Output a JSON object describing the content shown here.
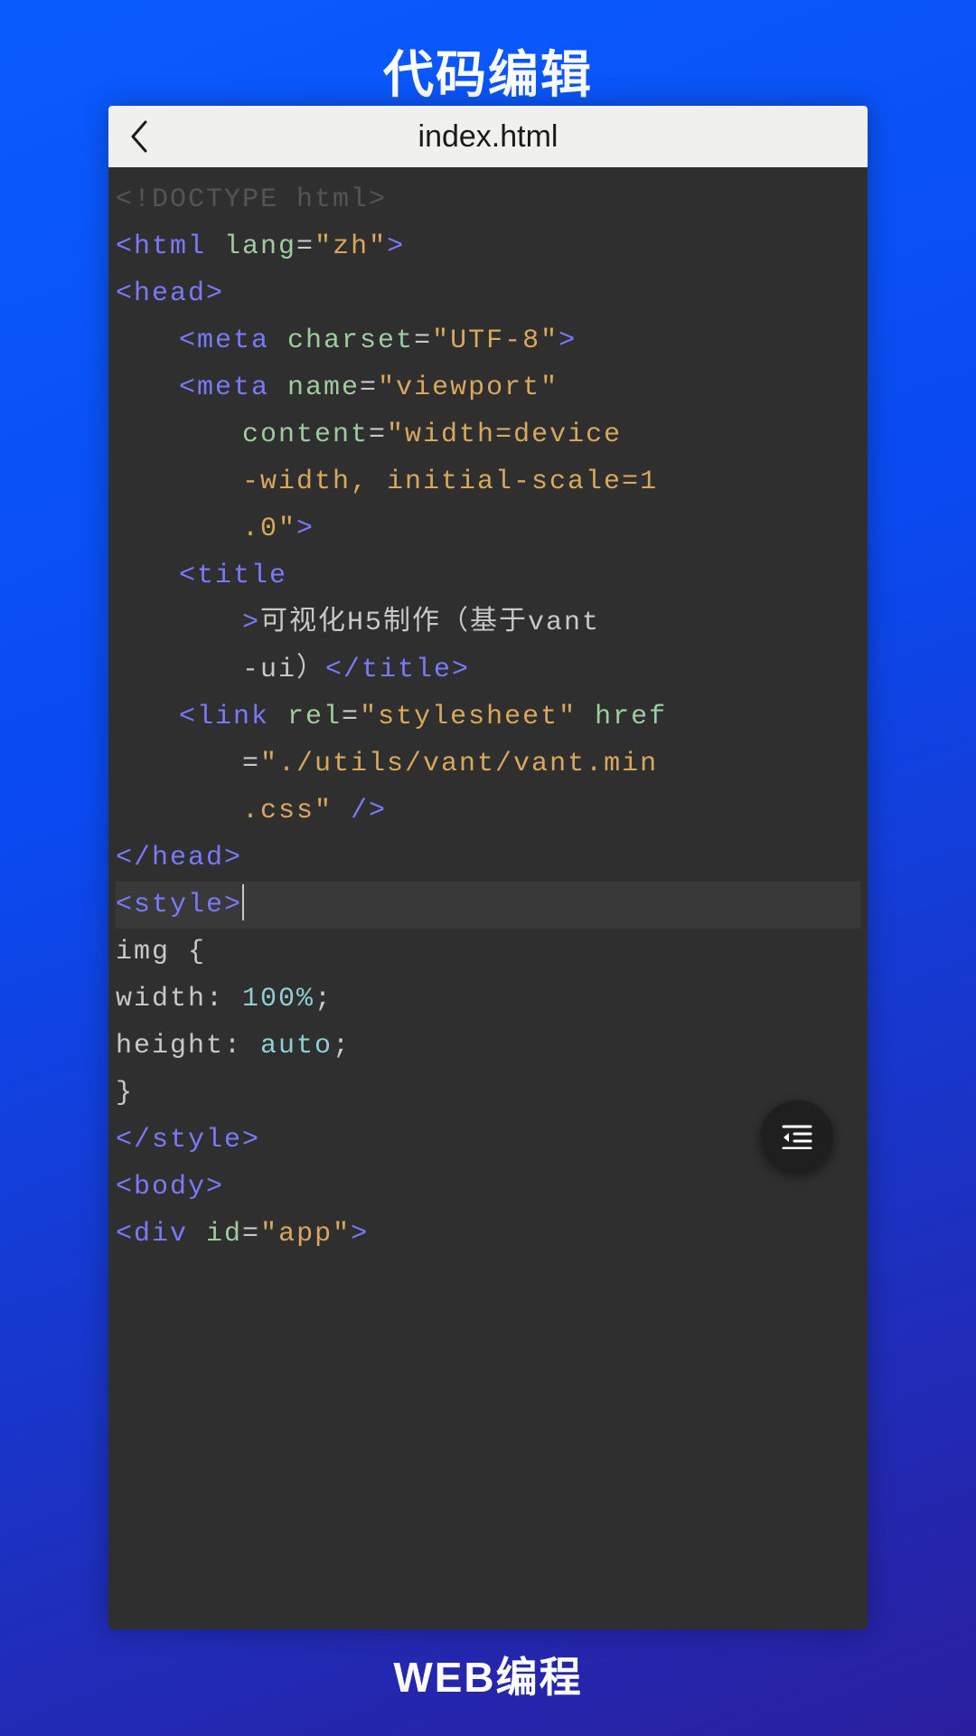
{
  "page": {
    "title": "代码编辑",
    "footer": "WEB编程"
  },
  "editor": {
    "filename": "index.html",
    "lines": {
      "doctype": "<!DOCTYPE html>",
      "html_open": "<html lang=\"zh\">",
      "head_open": "<head>",
      "meta_charset": "<meta charset=\"UTF-8\">",
      "meta_viewport_1": "<meta name=\"viewport\"",
      "meta_viewport_2": "content=\"width=device",
      "meta_viewport_3": "-width, initial-scale=1",
      "meta_viewport_4": ".0\">",
      "title_open": "<title",
      "title_text_1": ">可视化H5制作（基于vant",
      "title_text_2": "-ui）</title>",
      "link_1": "<link rel=\"stylesheet\" href",
      "link_2": "=\"./utils/vant/vant.min",
      "link_3": ".css\" />",
      "head_close": "</head>",
      "style_open": "<style>",
      "css_sel": "img {",
      "css_width": "width: 100%;",
      "css_height": "height: auto;",
      "css_close": "}",
      "style_close": "</style>",
      "body_open": "<body>",
      "div_app": "<div id=\"app\">"
    }
  }
}
